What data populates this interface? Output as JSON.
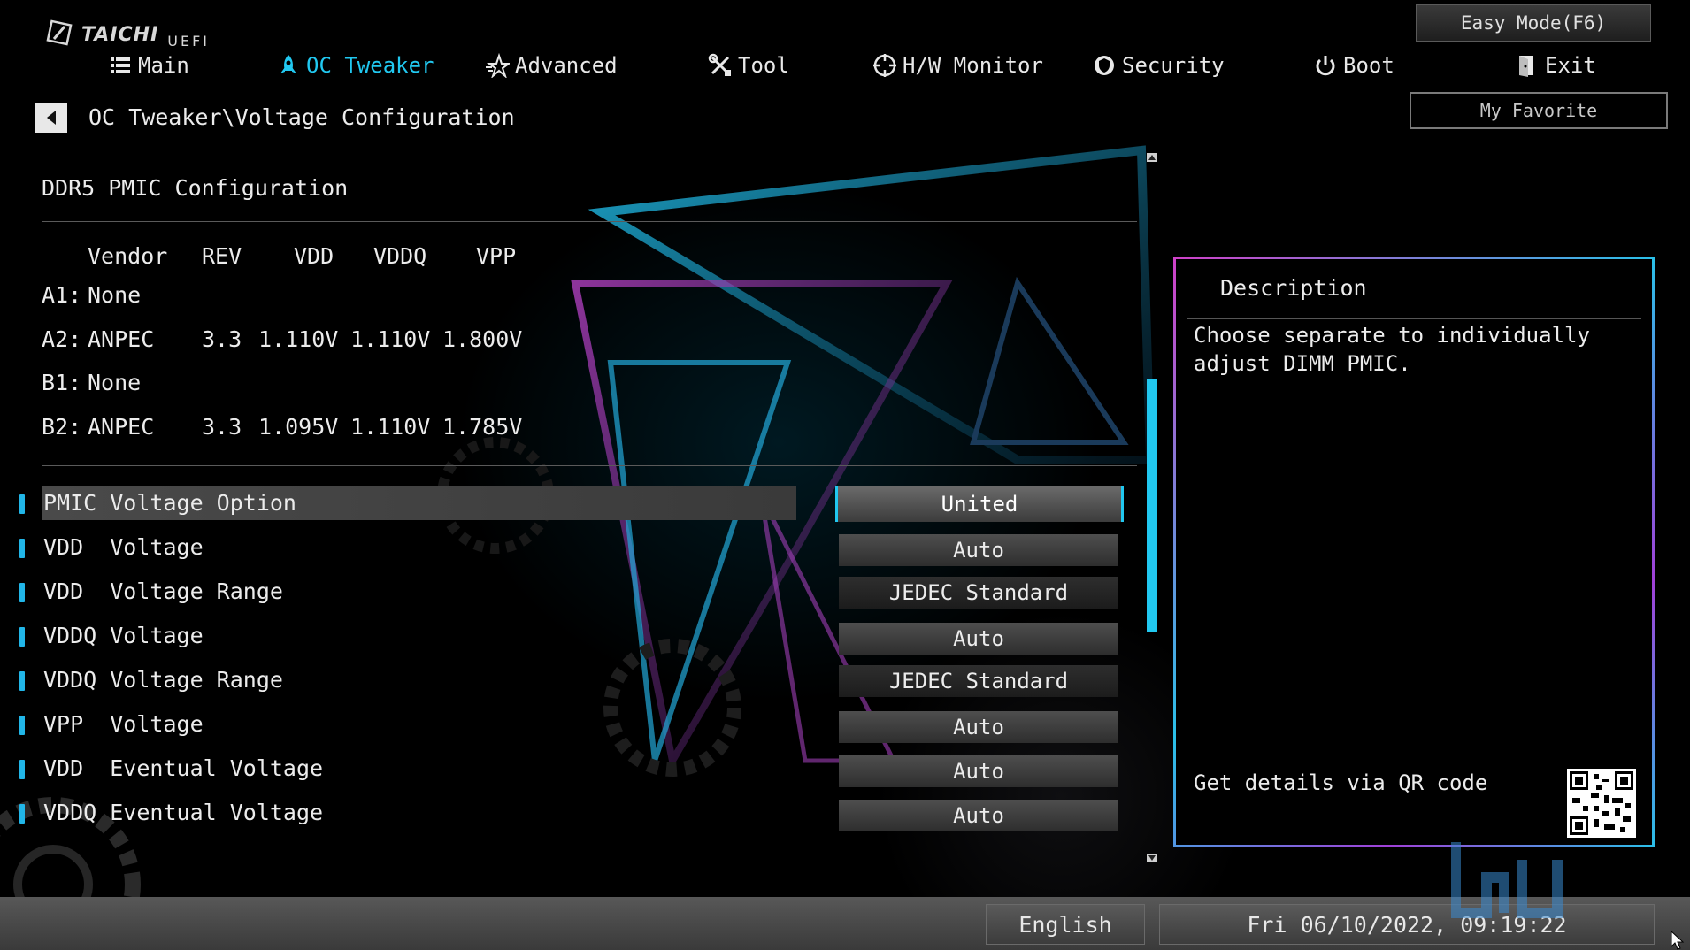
{
  "header": {
    "brand": "TAICHI",
    "brand_sub": "UEFI",
    "easy_mode_label": "Easy Mode(F6)",
    "my_favorite_label": "My Favorite"
  },
  "nav": {
    "items": [
      {
        "label": "Main",
        "icon": "list-icon"
      },
      {
        "label": "OC Tweaker",
        "icon": "rocket-icon",
        "active": true
      },
      {
        "label": "Advanced",
        "icon": "star-icon"
      },
      {
        "label": "Tool",
        "icon": "wrench-icon"
      },
      {
        "label": "H/W Monitor",
        "icon": "crosshair-icon"
      },
      {
        "label": "Security",
        "icon": "shield-icon"
      },
      {
        "label": "Boot",
        "icon": "power-icon"
      },
      {
        "label": "Exit",
        "icon": "exit-door-icon"
      }
    ]
  },
  "breadcrumb": {
    "path": "OC Tweaker\\Voltage Configuration"
  },
  "pmic": {
    "section_title": "DDR5 PMIC Configuration",
    "headers": [
      "Vendor",
      "REV",
      "VDD",
      "VDDQ",
      "VPP"
    ],
    "rows": [
      {
        "slot": "A1:",
        "vendor": "None",
        "rev": "",
        "vdd": "",
        "vddq": "",
        "vpp": ""
      },
      {
        "slot": "A2:",
        "vendor": "ANPEC",
        "rev": "3.3",
        "vdd": "1.110V",
        "vddq": "1.110V",
        "vpp": "1.800V"
      },
      {
        "slot": "B1:",
        "vendor": "None",
        "rev": "",
        "vdd": "",
        "vddq": "",
        "vpp": ""
      },
      {
        "slot": "B2:",
        "vendor": "ANPEC",
        "rev": "3.3",
        "vdd": "1.095V",
        "vddq": "1.110V",
        "vpp": "1.785V"
      }
    ]
  },
  "settings": [
    {
      "label": "PMIC Voltage Option",
      "value": "United",
      "selected": true
    },
    {
      "label": "VDD  Voltage",
      "value": "Auto"
    },
    {
      "label": "VDD  Voltage Range",
      "value": "JEDEC Standard"
    },
    {
      "label": "VDDQ Voltage",
      "value": "Auto"
    },
    {
      "label": "VDDQ Voltage Range",
      "value": "JEDEC Standard"
    },
    {
      "label": "VPP  Voltage",
      "value": "Auto"
    },
    {
      "label": "VDD  Eventual Voltage",
      "value": "Auto"
    },
    {
      "label": "VDDQ Eventual Voltage",
      "value": "Auto"
    }
  ],
  "description": {
    "title": "Description",
    "text": "Choose separate to individually\nadjust DIMM PMIC.",
    "qr_label": "Get details via QR code"
  },
  "footer": {
    "language": "English",
    "datetime": "Fri 06/10/2022, 09:19:22"
  },
  "colors": {
    "accent": "#21c8f0",
    "frame_pink": "#d040c8"
  }
}
